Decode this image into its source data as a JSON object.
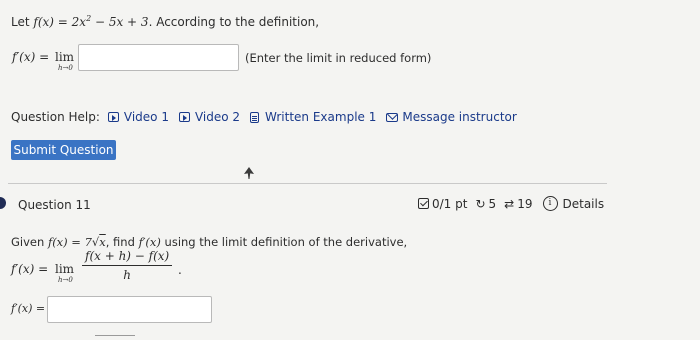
{
  "prev_question": {
    "prompt_pre": "Let ",
    "prompt_fx": "f(x) = 2x",
    "prompt_exp": "2",
    "prompt_rest": " − 5x + 3",
    "prompt_post": ". According to the definition,",
    "deriv_label": "f′(x) =",
    "lim_word": "lim",
    "lim_sub": "h→0",
    "answer_value": "",
    "hint": "(Enter the limit in reduced form)"
  },
  "help": {
    "label": "Question Help:",
    "links": [
      {
        "label": "Video 1",
        "icon": "video-icon"
      },
      {
        "label": "Video 2",
        "icon": "video-icon"
      },
      {
        "label": "Written Example 1",
        "icon": "document-icon"
      },
      {
        "label": "Message instructor",
        "icon": "mail-icon"
      }
    ]
  },
  "submit_label": "Submit Question",
  "question": {
    "title": "Question 11",
    "score": "0/1 pt",
    "retries": "5",
    "attempts": "19",
    "details": "Details",
    "prompt_pre": "Given ",
    "prompt_fx": "f(x) = 7",
    "prompt_rad": "x",
    "prompt_mid": ", find ",
    "prompt_fpx": "f′(x)",
    "prompt_post": " using the limit definition of the derivative,",
    "deriv_label": "f′(x) =",
    "lim_word": "lim",
    "lim_sub": "h→0",
    "numerator": "f(x + h) − f(x)",
    "denominator": "h",
    "answer_label": "f′(x) =",
    "answer_value": ""
  },
  "colors": {
    "accent": "#3a74c4",
    "link": "#1a3a8a",
    "bullet": "#1f2b55"
  }
}
